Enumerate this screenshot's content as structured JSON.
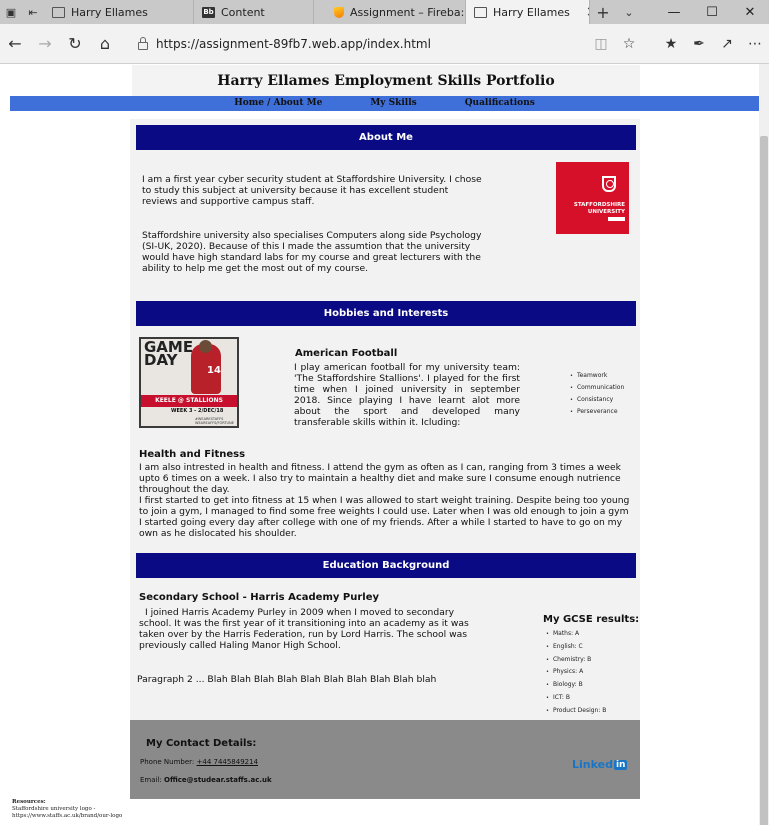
{
  "browser": {
    "tabs": [
      {
        "label": "Harry Ellames",
        "icon": "page-icon",
        "active": false
      },
      {
        "label": "Content",
        "icon": "blackboard-icon",
        "active": false
      },
      {
        "label": "Assignment – Fireba:",
        "icon": "firebase-icon",
        "active": false
      },
      {
        "label": "Harry Ellames",
        "icon": "page-icon",
        "active": true
      }
    ],
    "url": "https://assignment-89fb7.web.app/index.html",
    "bb_badge": "Bb"
  },
  "site": {
    "title": "Harry Ellames Employment Skills Portfolio",
    "nav": [
      "Home / About Me",
      "My Skills",
      "Qualifications"
    ]
  },
  "about": {
    "heading": "About Me",
    "p1": "I am a first year cyber security student at Staffordshire University. I chose to study this subject at university because it has excellent student reviews and supportive campus staff.",
    "p2": "Staffordshire university also specialises Computers along side Psychology (SI-UK, 2020). Because of this I made the assumtion that the university would have high standard labs for my course and great lecturers with the ability to help me get the most out of my course.",
    "logo_line1": "STAFFORDSHIRE",
    "logo_line2": "UNIVERSITY"
  },
  "hobbies": {
    "heading": "Hobbies and Interests",
    "poster": {
      "line1": "GAME",
      "line2": "DAY",
      "number": "14",
      "band": "KEELE @ STALLIONS",
      "week": "WEEK 3 - 2/DEC/18",
      "tag1": "#WEARESTAFFS",
      "tag2": "WEAREAFFS/FORTUNE"
    },
    "football_title": "American Football",
    "football_text": "I play american football for my university team: 'The Staffordshire Stallions'. I played for the first time when I joined university in september 2018. Since playing I have learnt alot more about the sport and developed many transferable skills within it. Icluding:",
    "skills": [
      "Teamwork",
      "Communication",
      "Consistancy",
      "Perseverance"
    ],
    "fitness_title": "Health and Fitness",
    "fitness_p1": "I am also intrested in health and fitness. I attend the gym as often as I can, ranging from 3 times a week upto 6 times on a week. I also try to maintain a healthy diet and make sure I consume enough nutrience throughout the day.",
    "fitness_p2": "I first started to get into fitness at 15 when I was allowed to start weight training. Despite being too young to join a gym, I managed to find some free weights I could use. Later when I was old enough to join a gym I started going every day after college with one of my friends. After a while I started to have to go on my own as he dislocated his shoulder."
  },
  "education": {
    "heading": "Education Background",
    "school_title": "Secondary School - Harris Academy Purley",
    "school_text": "I joined Harris Academy Purley in 2009 when I moved to secondary school. It was the first year of it transitioning into an academy as it was taken over by the Harris Federation, run by Lord Harris. The school was previously called Haling Manor High School.",
    "para2": "Paragraph 2 ... Blah Blah Blah Blah Blah Blah Blah Blah Blah blah",
    "gcse_title": "My GCSE results:",
    "gcse": [
      "Maths: A",
      "English: C",
      "Chemistry: B",
      "Physics: A",
      "Biology: B",
      "ICT: B",
      "Product Design: B"
    ]
  },
  "contact": {
    "title": "My Contact Details:",
    "phone_label": "Phone Number:",
    "phone": "+44 7445849214",
    "email_label": "Email:",
    "email": "Office@studear.staffs.ac.uk",
    "linkedin_text": "Linked",
    "linkedin_badge": "in"
  },
  "resources": {
    "title": "Resources:",
    "line1": "Staffordshire university logo -",
    "line2": "https://www.staffs.ac.uk/brand/our-logo"
  }
}
